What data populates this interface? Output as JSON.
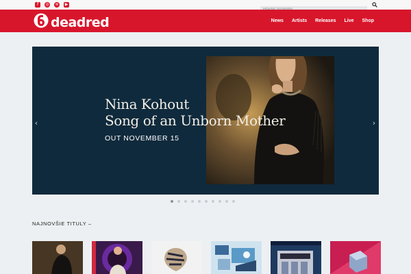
{
  "topbar": {
    "social": [
      {
        "name": "facebook-icon",
        "glyph": "f"
      },
      {
        "name": "instagram-icon",
        "glyph": "◎"
      },
      {
        "name": "spotify-icon",
        "glyph": "≋"
      },
      {
        "name": "youtube-icon",
        "glyph": "▶"
      }
    ],
    "search_placeholder": "Hľadať produkty...",
    "search_icon": "search-icon"
  },
  "header": {
    "logo_text": "deadred",
    "nav": [
      "News",
      "Artists",
      "Releases",
      "Live",
      "Shop"
    ],
    "brand_color": "#d8162b"
  },
  "hero": {
    "title_line1": "Nina Kohout",
    "title_line2": "Song of an Unborn Mother",
    "subtitle": "OUT NOVEMBER 15",
    "prev_icon": "chevron-left-icon",
    "next_icon": "chevron-right-icon",
    "slides_count": 10,
    "active_slide": 1,
    "background_color": "#0f2a3c"
  },
  "section": {
    "title": "NAJNOVŠIE TITULY –"
  },
  "releases": [
    {
      "art": "portrait-dark"
    },
    {
      "art": "portrait-purple"
    },
    {
      "art": "abstract-white"
    },
    {
      "art": "collage-blue"
    },
    {
      "art": "theatre-illustration"
    },
    {
      "art": "geometric-red"
    }
  ]
}
